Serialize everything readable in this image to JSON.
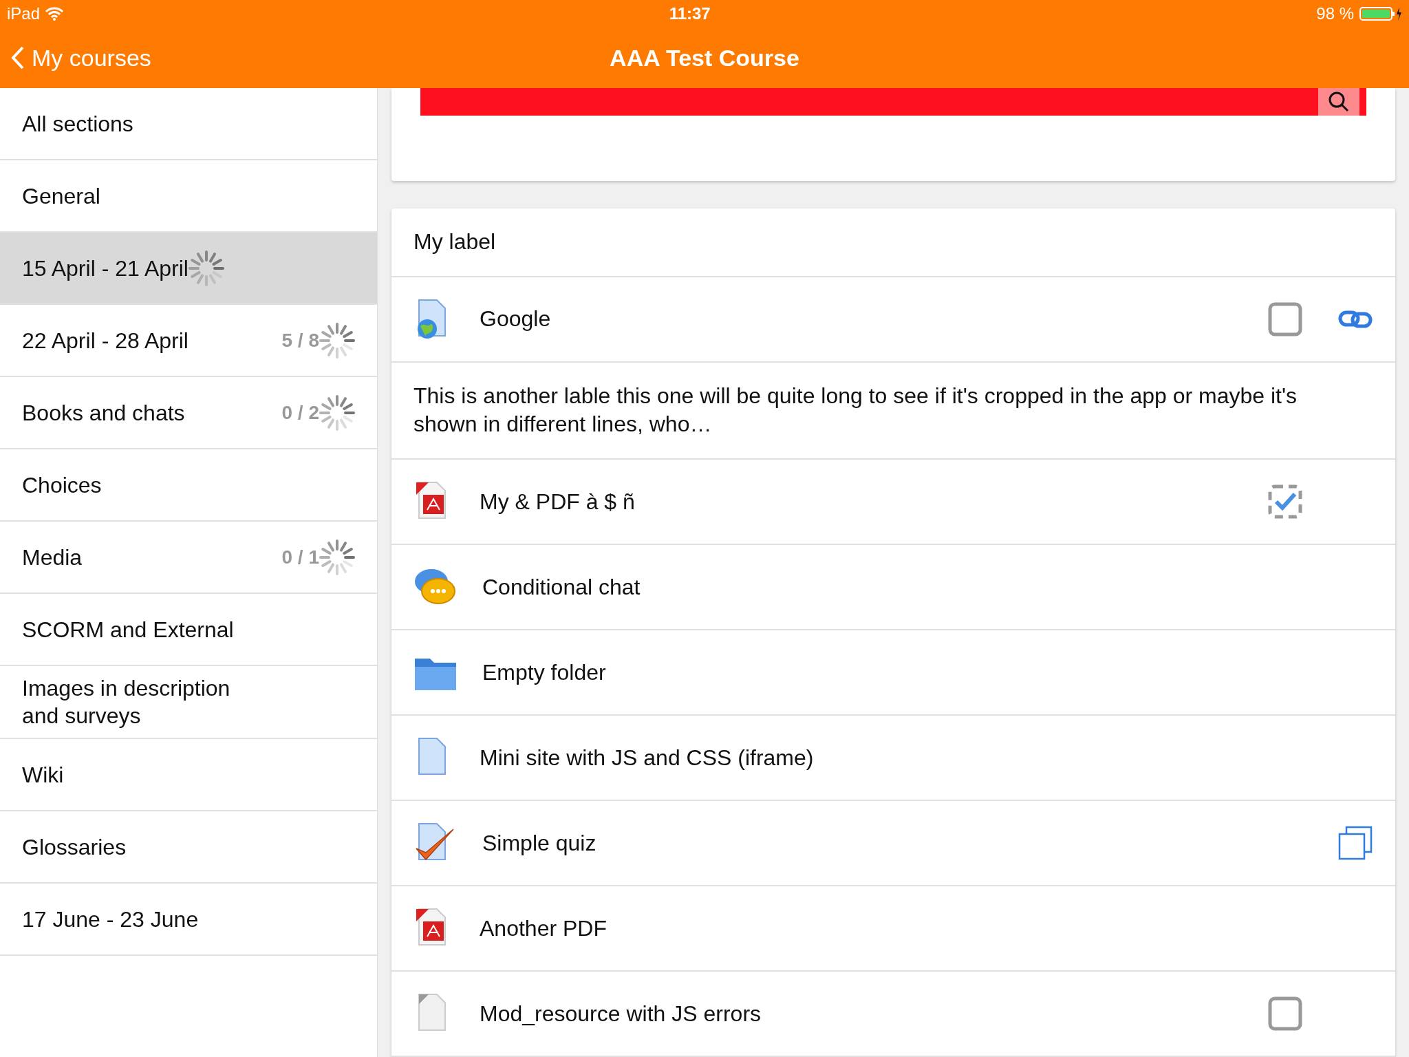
{
  "status_bar": {
    "device": "iPad",
    "time": "11:37",
    "battery": "98 %"
  },
  "nav_bar": {
    "back": "My courses",
    "title": "AAA Test Course"
  },
  "sidebar": {
    "items": [
      {
        "label": "All sections",
        "selected": false
      },
      {
        "label": "General",
        "selected": false
      },
      {
        "label": "15 April - 21 April",
        "selected": true,
        "loading": true
      },
      {
        "label": "22 April - 28 April",
        "selected": false,
        "progress": "5 / 8",
        "loading": true
      },
      {
        "label": "Books and chats",
        "selected": false,
        "progress": "0 / 2",
        "loading": true
      },
      {
        "label": "Choices",
        "selected": false
      },
      {
        "label": "Media",
        "selected": false,
        "progress": "0 / 1",
        "loading": true
      },
      {
        "label": "SCORM and External",
        "selected": false
      },
      {
        "label": "Images in description and surveys",
        "selected": false
      },
      {
        "label": "Wiki",
        "selected": false
      },
      {
        "label": "Glossaries",
        "selected": false
      },
      {
        "label": "17 June - 23 June",
        "selected": false
      }
    ]
  },
  "content": {
    "items": [
      {
        "kind": "label",
        "text": "My label"
      },
      {
        "kind": "url",
        "name": "Google",
        "completion": {
          "kind": "manual",
          "checked": false
        },
        "action": {
          "kind": "link"
        }
      },
      {
        "kind": "label",
        "text": "This is another lable this one will be quite long to see if it's cropped in the app or maybe it's shown in different lines, who…"
      },
      {
        "kind": "pdf",
        "name": "My & PDF à $ ñ",
        "completion": {
          "kind": "auto",
          "checked": true
        }
      },
      {
        "kind": "chat",
        "name": "Conditional chat"
      },
      {
        "kind": "folder",
        "name": "Empty folder"
      },
      {
        "kind": "page",
        "name": "Mini site with JS and CSS (iframe)"
      },
      {
        "kind": "quiz",
        "name": "Simple quiz",
        "action": {
          "kind": "copy"
        }
      },
      {
        "kind": "pdf",
        "name": "Another PDF"
      },
      {
        "kind": "file",
        "name": "Mod_resource with JS errors",
        "completion": {
          "kind": "manual",
          "checked": false
        }
      }
    ]
  }
}
